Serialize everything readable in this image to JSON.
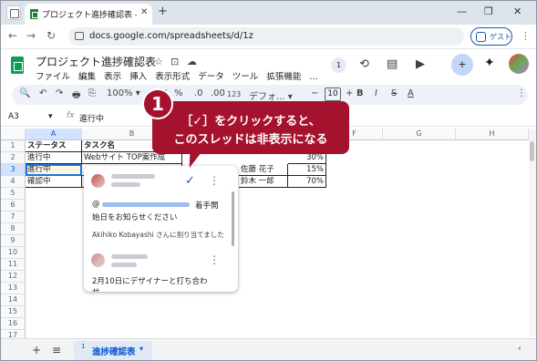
{
  "browser": {
    "tab_title": "プロジェクト進捗確認表 - Google",
    "tab_close": "✕",
    "new_tab": "+",
    "minimize": "—",
    "maximize": "❐",
    "close": "✕",
    "back": "←",
    "forward": "→",
    "reload": "↻",
    "url": "docs.google.com/spreadsheets/d/1z",
    "guest_label": "ゲスト",
    "menu": "⋮"
  },
  "sheets": {
    "doc_title": "プロジェクト進捗確認表",
    "star": "☆",
    "move": "⊡",
    "cloud": "☁",
    "menus": [
      "ファイル",
      "編集",
      "表示",
      "挿入",
      "表示形式",
      "データ",
      "ツール",
      "拡張機能",
      "…"
    ],
    "comment_count": "1",
    "share_icon": "+",
    "gemini": "✦"
  },
  "toolbar": {
    "search": "🔍",
    "undo": "↶",
    "redo": "↷",
    "print": "🖶",
    "paint": "⎘",
    "zoom": "100%",
    "zoom_caret": "▾",
    "currency": "¥",
    "percent": "%",
    "dec_minus": ".0",
    "dec_plus": ".00",
    "num_format": "123",
    "font": "デフォ...",
    "font_caret": "▾",
    "minus": "−",
    "font_size": "10",
    "plus": "+",
    "bold": "B",
    "italic": "I",
    "strike": "S",
    "text_color": "A",
    "more": "⋮"
  },
  "formula_bar": {
    "cell_ref": "A3",
    "cell_ref_caret": "▾",
    "fx": "fx",
    "value": "進行中"
  },
  "grid": {
    "columns": [
      "A",
      "B",
      "C",
      "D",
      "E",
      "F",
      "G",
      "H"
    ],
    "rows": [
      "1",
      "2",
      "3",
      "4",
      "5",
      "6",
      "7",
      "8",
      "9",
      "10",
      "11",
      "12",
      "13",
      "14",
      "15",
      "16",
      "17"
    ],
    "headers": [
      "ステータス",
      "タスク名"
    ],
    "cells": {
      "a2": "進行中",
      "b2": "Webサイト TOP案作成",
      "e2": "30%",
      "a3": "進行中",
      "d3": "佐藤 花子",
      "e3": "15%",
      "a4": "確認中",
      "d4": "鈴木 一郎",
      "e4": "70%"
    }
  },
  "comment": {
    "resolve_icon": "✓",
    "more_icon": "⋮",
    "mention_prefix": "@",
    "mention_suffix": "着手開",
    "line2": "始日をお知らせください",
    "assigned": "Akihiko Kobayashi さんに割り当てました",
    "more_icon_2": "⋮",
    "reply_text": "2月10日にデザイナーと打ち合わ",
    "reply_text2": "せ"
  },
  "callout": {
    "step": "1",
    "line1": "［✓］をクリックすると、",
    "line2": "このスレッドは非表示になる"
  },
  "sheetbar": {
    "add": "+",
    "list": "≡",
    "sheet_num": "1",
    "sheet_name": "進捗確認表",
    "sheet_caret": "▾",
    "scroll_right": "‹"
  },
  "colors": {
    "accent": "#1a73e8",
    "callout": "#a5122d",
    "sheets_green": "#0f9d58"
  }
}
